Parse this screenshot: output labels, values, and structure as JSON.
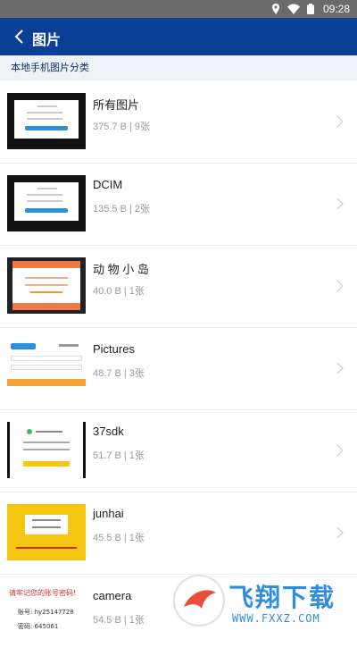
{
  "status_bar": {
    "time": "09:28"
  },
  "app_bar": {
    "title": "图片"
  },
  "section": {
    "header": "本地手机图片分类"
  },
  "albums": [
    {
      "name": "所有图片",
      "meta": "375.7 B | 9张"
    },
    {
      "name": "DCIM",
      "meta": "135.5 B | 2张"
    },
    {
      "name": "动 物 小 岛",
      "meta": "40.0 B | 1张"
    },
    {
      "name": "Pictures",
      "meta": "48.7 B | 3张"
    },
    {
      "name": "37sdk",
      "meta": "51.7 B | 1张"
    },
    {
      "name": "junhai",
      "meta": "45.5 B | 1张"
    },
    {
      "name": "camera",
      "meta": "54.5 B | 1张"
    }
  ],
  "thumb_text": {
    "camera_line1": "请牢记您的账号密码!",
    "camera_line2": "账号: hy25147728",
    "camera_line3": "密码: 645061"
  },
  "watermark": {
    "brand": "飞翔下载",
    "url": "WWW.FXXZ.COM"
  },
  "colors": {
    "app_bar": "#0b3f96",
    "status_bar": "#6b6b6b",
    "accent_blue": "#2f8de0",
    "accent_orange": "#ef7a45",
    "accent_yellow": "#f4c512"
  }
}
